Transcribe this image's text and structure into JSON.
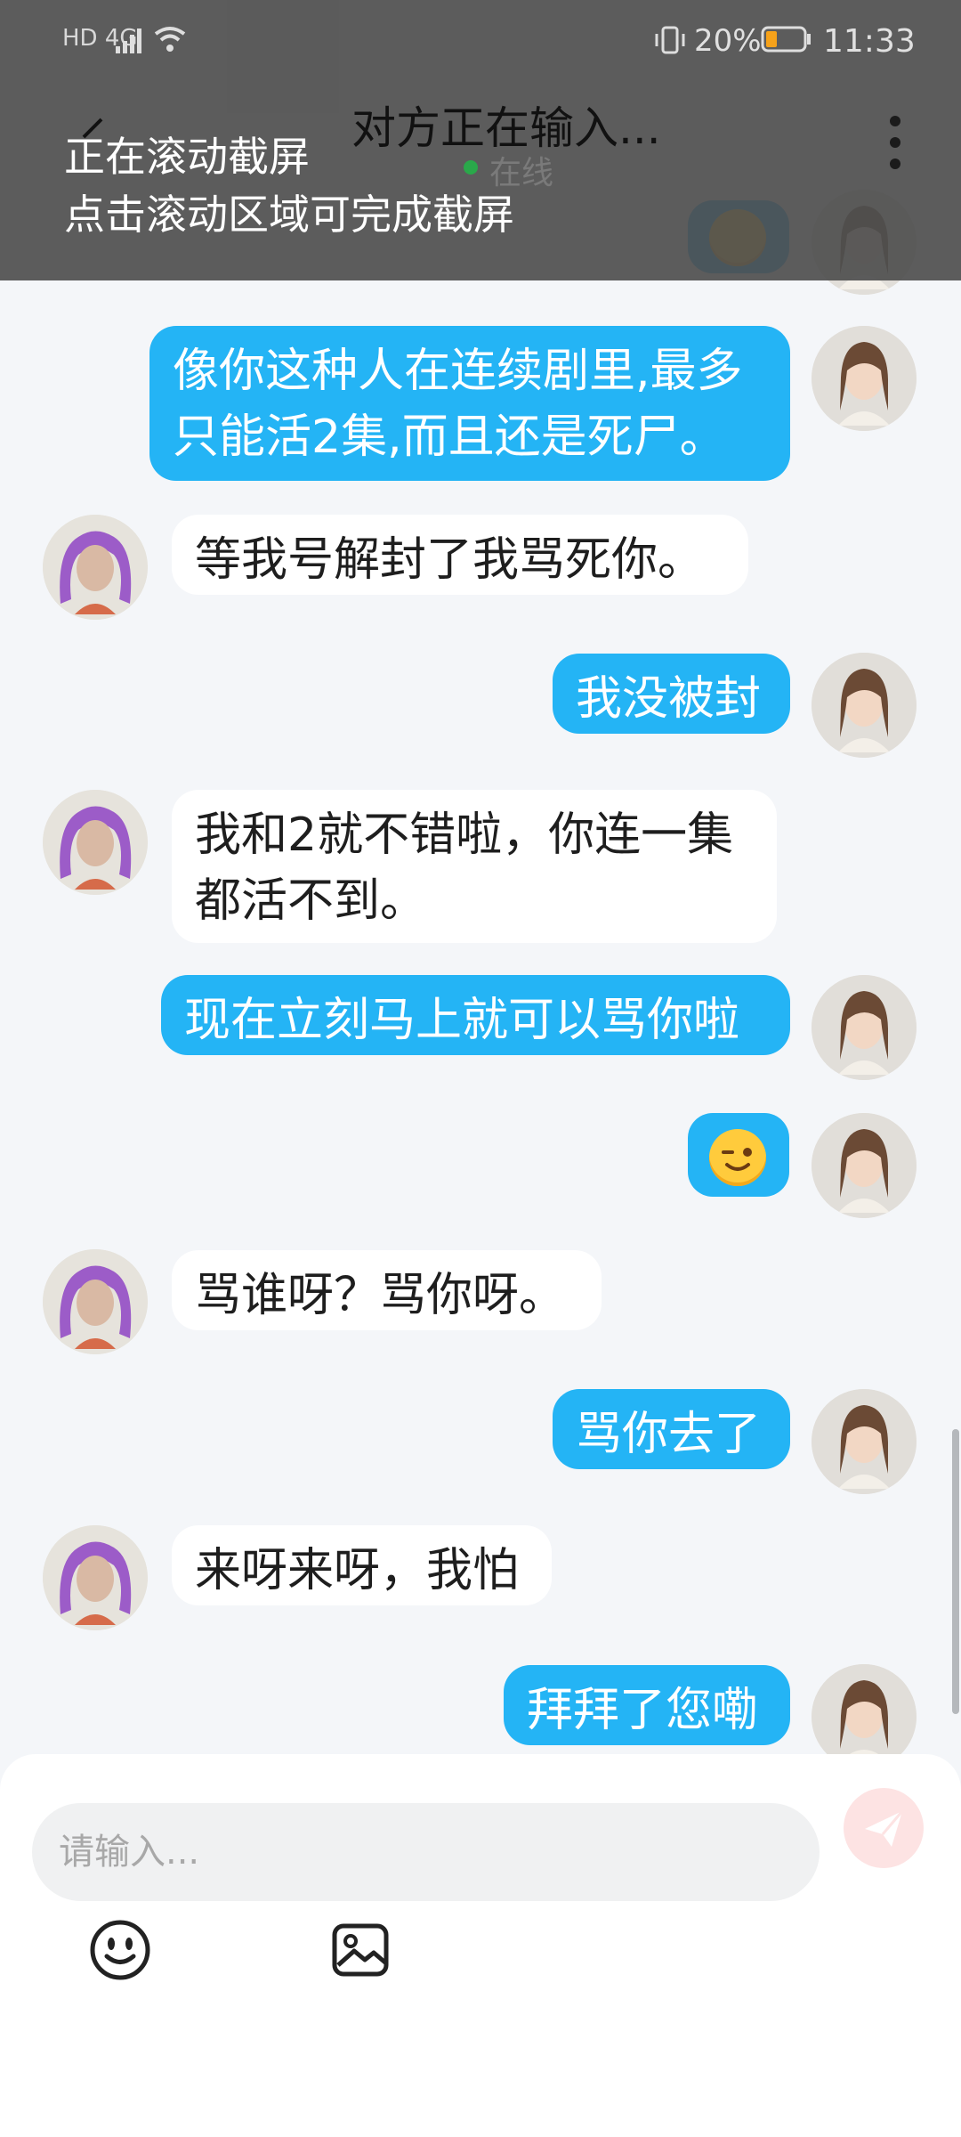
{
  "status_bar": {
    "left": "HD 4G",
    "battery": "20%",
    "time": "11:33"
  },
  "header": {
    "title": "对方正在输入...",
    "online": "在线"
  },
  "screenshot_toast": {
    "line1": "正在滚动截屏",
    "line2": "点击滚动区域可完成截屏"
  },
  "messages": [
    {
      "from": "me",
      "text": "像你这种人在连续剧里,最多只能活2集,而且还是死尸。"
    },
    {
      "from": "them",
      "text": "等我号解封了我骂死你。"
    },
    {
      "from": "me",
      "text": "我没被封"
    },
    {
      "from": "them",
      "text": "我和2就不错啦，你连一集都活不到。"
    },
    {
      "from": "me",
      "text": "现在立刻马上就可以骂你啦"
    },
    {
      "from": "me",
      "text": "😉"
    },
    {
      "from": "them",
      "text": "骂谁呀？骂你呀。"
    },
    {
      "from": "me",
      "text": "骂你去了"
    },
    {
      "from": "them",
      "text": "来呀来呀，我怕"
    },
    {
      "from": "me",
      "text": "拜拜了您嘞"
    }
  ],
  "input": {
    "placeholder": "请输入..."
  },
  "colors": {
    "me_bubble": "#24b4f5",
    "them_bubble": "#ffffff",
    "background": "#f4f6f9"
  }
}
